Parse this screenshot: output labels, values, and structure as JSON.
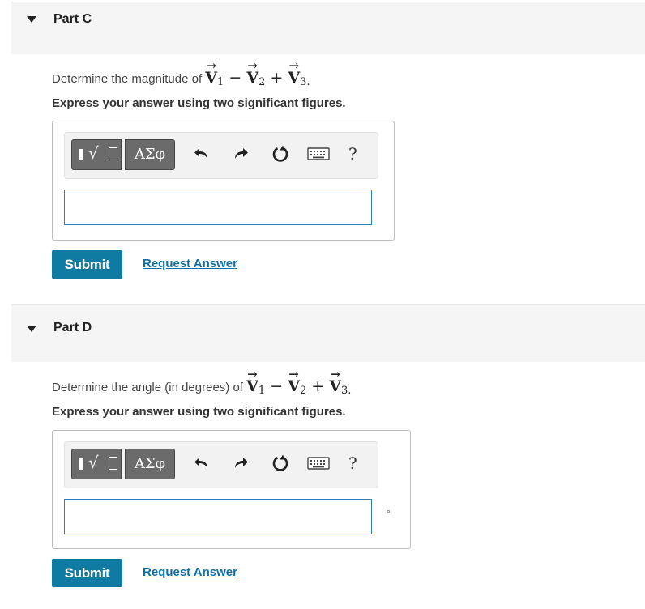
{
  "parts": [
    {
      "title": "Part C",
      "question_prefix": "Determine the magnitude of",
      "vector_symbol": "V",
      "subscripts": [
        "1",
        "2",
        "3"
      ],
      "operators": [
        "−",
        "+"
      ],
      "period": ".",
      "instruction": "Express your answer using two significant figures.",
      "toolbar": {
        "templates_icon": "sqrt-template-icon",
        "greek_label": "ΑΣφ",
        "undo_icon": "undo-icon",
        "redo_icon": "redo-icon",
        "reset_icon": "reset-icon",
        "keyboard_icon": "keyboard-icon",
        "help_label": "?"
      },
      "answer_value": "",
      "unit": "",
      "submit_label": "Submit",
      "request_label": "Request Answer"
    },
    {
      "title": "Part D",
      "question_prefix": "Determine the angle (in degrees) of",
      "vector_symbol": "V",
      "subscripts": [
        "1",
        "2",
        "3"
      ],
      "operators": [
        "−",
        "+"
      ],
      "period": ".",
      "instruction": "Express your answer using two significant figures.",
      "toolbar": {
        "templates_icon": "sqrt-template-icon",
        "greek_label": "ΑΣφ",
        "undo_icon": "undo-icon",
        "redo_icon": "redo-icon",
        "reset_icon": "reset-icon",
        "keyboard_icon": "keyboard-icon",
        "help_label": "?"
      },
      "answer_value": "",
      "unit": "°",
      "submit_label": "Submit",
      "request_label": "Request Answer"
    }
  ],
  "colors": {
    "header_bg": "#f5f5f5",
    "submit_bg": "#0f7aa2",
    "link": "#0d6fa3",
    "input_border": "#2d7cb5"
  }
}
